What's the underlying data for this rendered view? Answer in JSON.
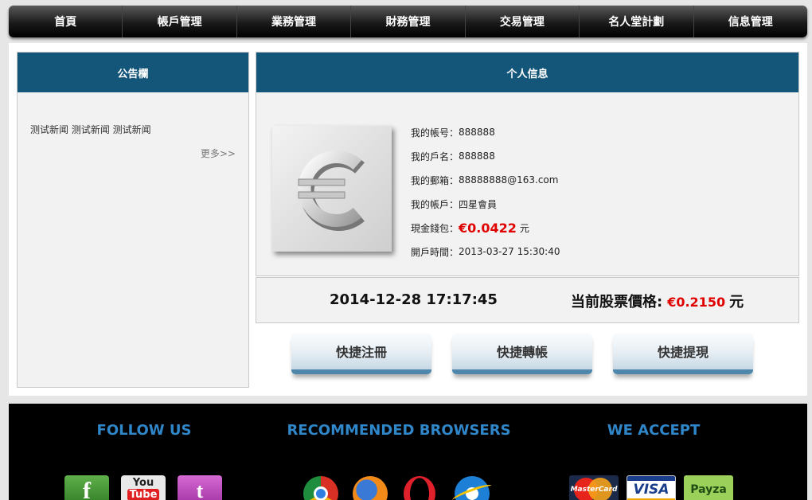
{
  "nav": {
    "items": [
      {
        "label": "首頁"
      },
      {
        "label": "帳戶管理"
      },
      {
        "label": "業務管理"
      },
      {
        "label": "財務管理"
      },
      {
        "label": "交易管理"
      },
      {
        "label": "名人堂計劃"
      },
      {
        "label": "信息管理"
      }
    ]
  },
  "notice": {
    "title": "公告欄",
    "text": "测试新闻 测试新闻 测试新闻",
    "more": "更多>>"
  },
  "profile": {
    "title": "个人信息",
    "account_label": "我的帳号：",
    "account": "888888",
    "name_label": "我的戶名：",
    "name": "888888",
    "email_label": "我的郵箱：",
    "email": "88888888@163.com",
    "type_label": "我的帳戶：",
    "type": "四星會員",
    "wallet_label": "現金錢包：",
    "wallet": "€0.0422",
    "wallet_unit": "元",
    "opened_label": "開戶時間：",
    "opened": "2013-03-27 15:30:40"
  },
  "ticker": {
    "datetime": "2014-12-28 17:17:45",
    "price_label": "当前股票價格:",
    "price": "€0.2150",
    "unit": "元"
  },
  "quick": {
    "register": "快捷注冊",
    "transfer": "快捷轉帳",
    "withdraw": "快捷提現"
  },
  "footer": {
    "follow": "FOLLOW US",
    "browsers": "RECOMMENDED BROWSERS",
    "accept": "WE ACCEPT",
    "youtube_top": "You",
    "youtube_bottom": "Tube",
    "mastercard": "MasterCard",
    "visa": "VISA",
    "payza": "Payza"
  },
  "colors": {
    "panel_header": "#14557a",
    "footer_title": "#2f86c8",
    "money": "#e00000"
  }
}
